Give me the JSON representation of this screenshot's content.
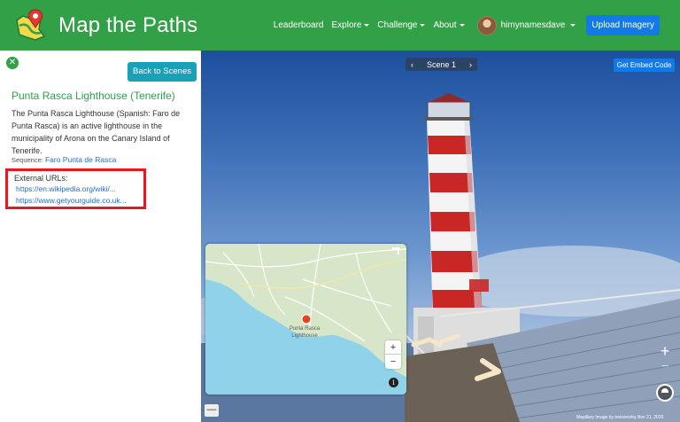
{
  "navbar": {
    "brand": "Map the Paths",
    "items": [
      {
        "label": "Leaderboard",
        "dropdown": false
      },
      {
        "label": "Explore",
        "dropdown": true
      },
      {
        "label": "Challenge",
        "dropdown": true
      },
      {
        "label": "About",
        "dropdown": true
      }
    ],
    "username": "himynamesdave",
    "upload_label": "Upload Imagery",
    "color": "#31a047"
  },
  "sidebar": {
    "close_icon": "close-circle-icon",
    "back_label": "Back to Scenes",
    "title": "Punta Rasca Lighthouse (Tenerife)",
    "description": "The Punta Rasca Lighthouse (Spanish: Faro de Punta Rasca) is an active lighthouse in the municipality of Arona on the Canary Island of Tenerife.",
    "sequence_label": "Sequence:",
    "sequence_link": "Faro Punta de Rasca",
    "external_label": "External URLs:",
    "urls": [
      "https://en.wikipedia.org/wiki/...",
      "https://www.getyourguide.co.uk..."
    ]
  },
  "viewer": {
    "scene_label": "Scene 1",
    "embed_label": "Get Embed Code",
    "zoom_in": "+",
    "zoom_out": "−",
    "minimize": "—",
    "attribution_brand": "Mapillary",
    "attribution_text": "Image by trekviewhq Nov 21, 2020"
  },
  "minimap": {
    "label": "Punta Rasca Lighthouse",
    "zoom_in": "+",
    "zoom_out": "−",
    "info": "i"
  }
}
